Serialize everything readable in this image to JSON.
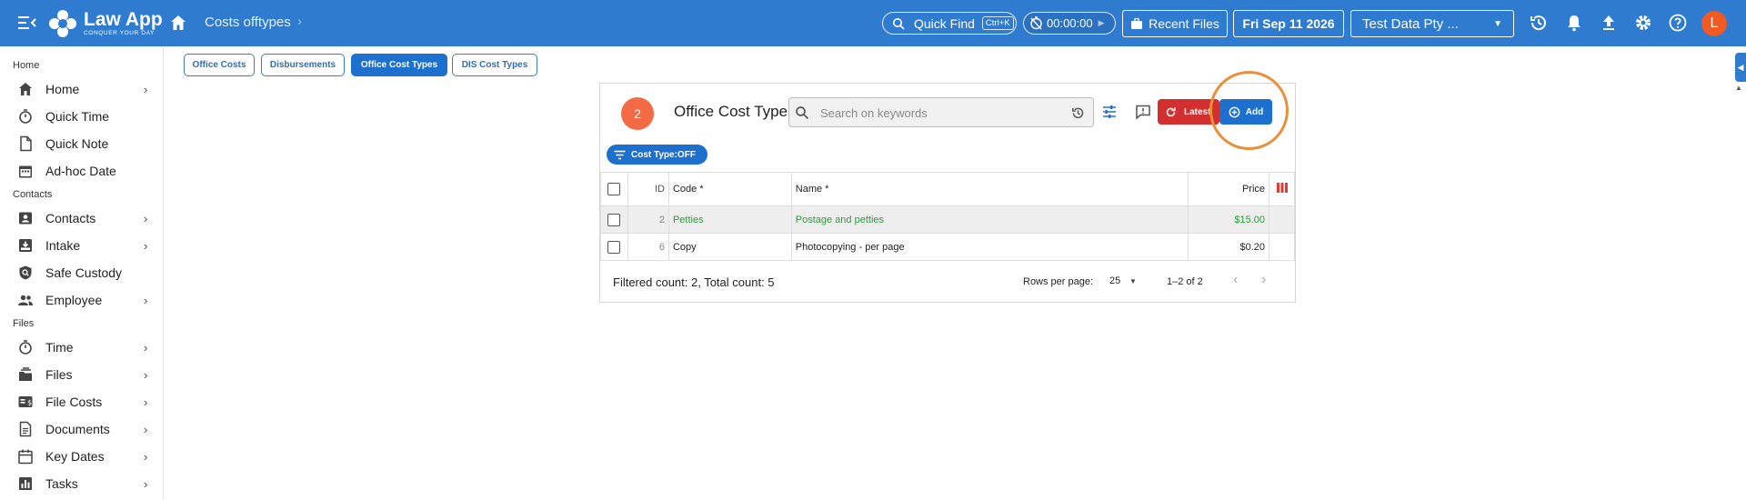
{
  "app": {
    "logo_name": "Law App",
    "logo_tagline": "CONQUER YOUR DAY",
    "breadcrumb_title": "Costs offtypes",
    "breadcrumb_chevron": "›"
  },
  "topbar": {
    "quick_find_label": "Quick Find",
    "quick_find_shortcut": "Ctrl+K",
    "timer_value": "00:00:00",
    "recent_files_label": "Recent Files",
    "date_label": "Fri Sep 11 2026",
    "entity_select_value": "Test Data Pty ...",
    "avatar_initial": "L"
  },
  "sidebar": {
    "sections": [
      "Home",
      "Contacts",
      "Files"
    ],
    "items": [
      {
        "label": "Home",
        "icon": "home-icon",
        "has_children": true
      },
      {
        "label": "Quick Time",
        "icon": "stopwatch-icon",
        "has_children": false
      },
      {
        "label": "Quick Note",
        "icon": "note-icon",
        "has_children": false
      },
      {
        "label": "Ad-hoc Date",
        "icon": "calendar-icon",
        "has_children": false
      },
      {
        "label": "Contacts",
        "icon": "contacts-icon",
        "has_children": true
      },
      {
        "label": "Intake",
        "icon": "intake-icon",
        "has_children": true
      },
      {
        "label": "Safe Custody",
        "icon": "safe-custody-icon",
        "has_children": false
      },
      {
        "label": "Employee",
        "icon": "people-icon",
        "has_children": true
      },
      {
        "label": "Time",
        "icon": "stopwatch-icon",
        "has_children": true
      },
      {
        "label": "Files",
        "icon": "files-icon",
        "has_children": true
      },
      {
        "label": "File Costs",
        "icon": "money-icon",
        "has_children": true
      },
      {
        "label": "Documents",
        "icon": "document-icon",
        "has_children": true
      },
      {
        "label": "Key Dates",
        "icon": "calendar-icon",
        "has_children": true
      },
      {
        "label": "Tasks",
        "icon": "chart-icon",
        "has_children": true
      }
    ],
    "chevron": "›"
  },
  "tabs": [
    {
      "label": "Office Costs",
      "active": false
    },
    {
      "label": "Disbursements",
      "active": false
    },
    {
      "label": "Office Cost Types",
      "active": true
    },
    {
      "label": "DIS Cost Types",
      "active": false
    }
  ],
  "panel": {
    "badge_count": "2",
    "title": "Office Cost Type",
    "search_placeholder": "Search on keywords",
    "latest_label": "Latest",
    "add_label": "Add",
    "filter_chip_label": "Cost Type:OFF",
    "columns": [
      "ID",
      "Code *",
      "Name *",
      "Price"
    ],
    "rows": [
      {
        "id": "2",
        "code": "Petties",
        "name": "Postage and petties",
        "price": "$15.00",
        "highlighted": true
      },
      {
        "id": "6",
        "code": "Copy",
        "name": "Photocopying - per page",
        "price": "$0.20",
        "highlighted": false
      }
    ],
    "footer_count": "Filtered count: 2, Total count: 5",
    "rows_per_page_label": "Rows per page:",
    "rows_per_page_value": "25",
    "range_label": "1–2 of 2"
  },
  "colors": {
    "topbar": "#2f7bd0",
    "primary": "#1e70cf",
    "latest_red": "#d32f2f",
    "badge_orange": "#f46a45",
    "highlight_ring": "#e8913a",
    "row_green_text": "#2e9b3c",
    "avatar": "#f15a22"
  }
}
